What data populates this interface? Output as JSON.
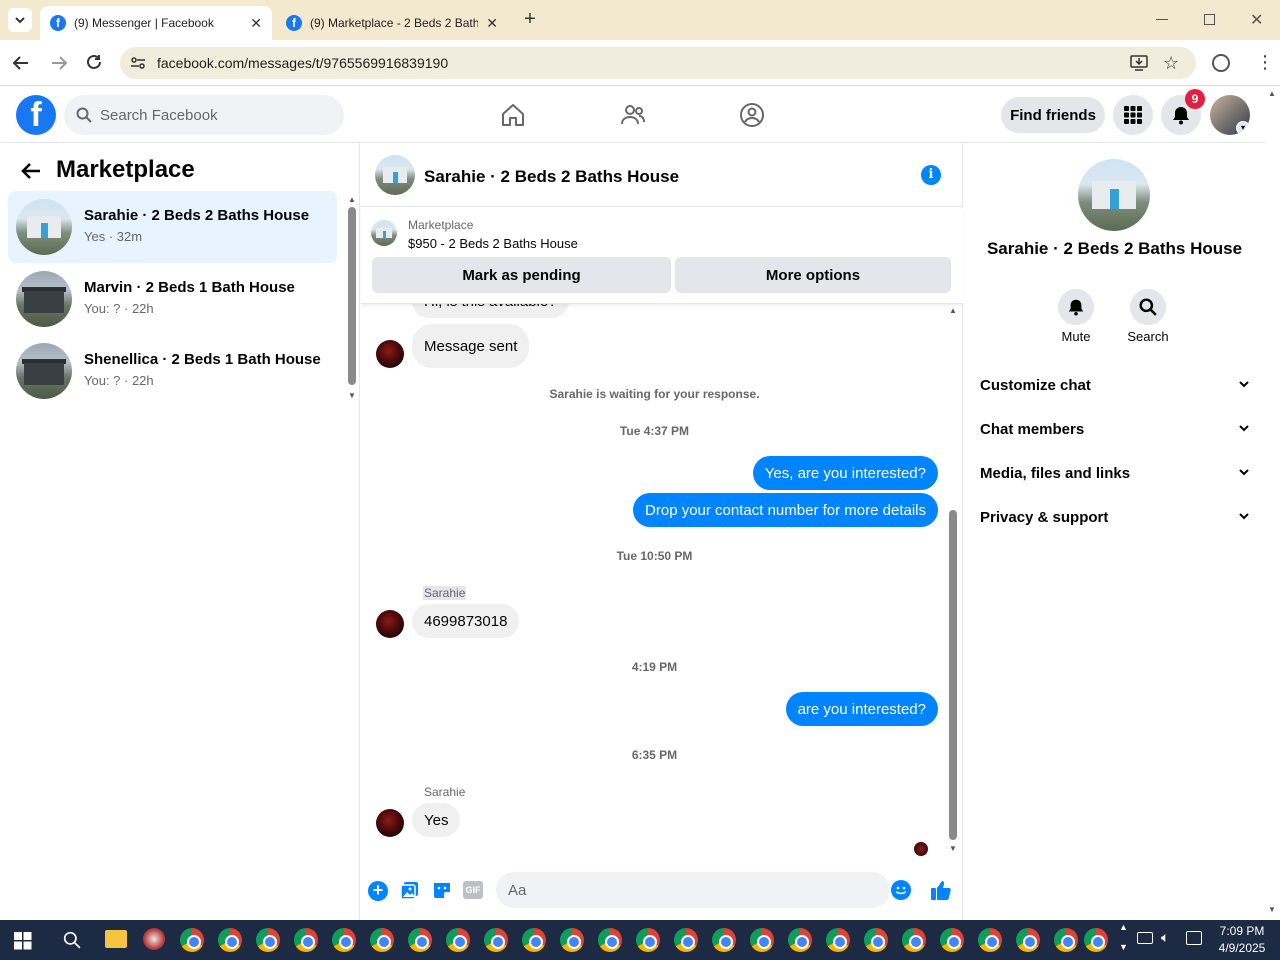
{
  "browser": {
    "tabs": [
      {
        "title": "(9) Messenger | Facebook",
        "active": true
      },
      {
        "title": "(9) Marketplace - 2 Beds 2 Bath",
        "active": false
      }
    ],
    "url": "facebook.com/messages/t/9765569916839190"
  },
  "header": {
    "search_placeholder": "Search Facebook",
    "find_friends": "Find friends",
    "notifications_count": "9",
    "colors": {
      "brand": "#1877f2",
      "badge": "#e41e3f"
    }
  },
  "sidebar": {
    "title": "Marketplace",
    "conversations": [
      {
        "name": "Sarahie · 2 Beds 2 Baths House",
        "preview": "Yes · 32m",
        "active": true
      },
      {
        "name": "Marvin · 2 Beds 1 Bath House",
        "preview": "You: ? · 22h",
        "active": false
      },
      {
        "name": "Shenellica · 2 Beds 1 Bath House",
        "preview": "You: ? · 22h",
        "active": false
      }
    ]
  },
  "chat": {
    "title": "Sarahie · 2 Beds 2 Baths House",
    "listing": {
      "source": "Marketplace",
      "summary": "$950 - 2 Beds 2 Baths House",
      "mark_pending": "Mark as pending",
      "more_options": "More options"
    },
    "messages": {
      "partial_top": "Hi, is this available?",
      "message_sent": "Message sent",
      "waiting_note": "Sarahie is waiting for your response.",
      "ts1": "Tue 4:37 PM",
      "out1": "Yes, are you interested?",
      "out2": "Drop your contact number for more details",
      "ts2": "Tue 10:50 PM",
      "sender1": "Sarahie",
      "in_phone": "4699873018",
      "ts3": "4:19 PM",
      "out3": "are you interested?",
      "ts4": "6:35 PM",
      "sender2": "Sarahie",
      "in_yes": "Yes"
    },
    "composer_placeholder": "Aa",
    "colors": {
      "outgoing": "#0084ff",
      "incoming": "#f0f0f0"
    }
  },
  "details": {
    "title": "Sarahie · 2 Beds 2 Baths House",
    "mute": "Mute",
    "search": "Search",
    "sections": [
      "Customize chat",
      "Chat members",
      "Media, files and links",
      "Privacy & support"
    ]
  },
  "taskbar": {
    "time": "7:09 PM",
    "date": "4/9/2025"
  }
}
